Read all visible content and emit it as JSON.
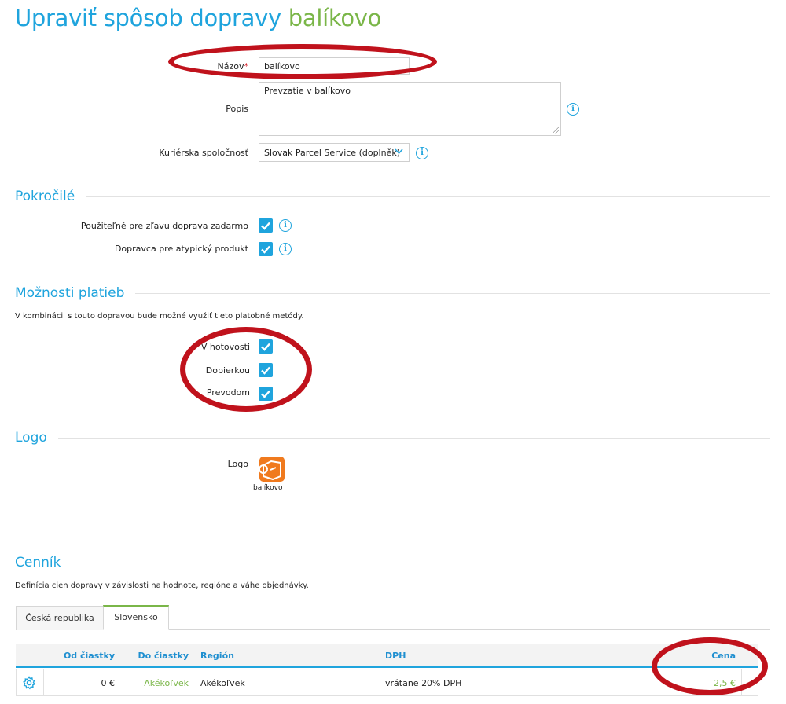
{
  "title": {
    "main": "Upraviť spôsob dopravy",
    "name": "balíkovo"
  },
  "form": {
    "name_label": "Názov",
    "required_mark": "*",
    "name_value": "balíkovo",
    "desc_label": "Popis",
    "desc_value": "Prevzatie v balíkovo",
    "courier_label": "Kuriérska spoločnosť",
    "courier_value": "Slovak Parcel Service (doplněk)",
    "info_glyph": "i"
  },
  "advanced": {
    "title": "Pokročilé",
    "free_shipping_label": "Použiteľné pre zľavu doprava zadarmo",
    "atypical_label": "Dopravca pre atypický produkt"
  },
  "payments": {
    "title": "Možnosti platieb",
    "description": "V kombinácii s touto dopravou bude možné využiť tieto platobné metódy.",
    "methods": [
      "V hotovosti",
      "Dobierkou",
      "Prevodom"
    ]
  },
  "logo": {
    "title": "Logo",
    "label": "Logo",
    "caption": "balíkovo",
    "color": "#f07a1e"
  },
  "pricing": {
    "title": "Cenník",
    "description": "Definícia cien dopravy v závislosti na hodnote, regióne a váhe objednávky.",
    "tabs": [
      "Česká republika",
      "Slovensko"
    ],
    "active_tab": 1,
    "columns": [
      "Od čiastky",
      "Do čiastky",
      "Región",
      "DPH",
      "Cena"
    ],
    "rows": [
      {
        "from": "0 €",
        "to": "Akékoľvek",
        "region": "Akékoľvek",
        "vat": "vrátane 20% DPH",
        "price": "2,5 €"
      }
    ]
  },
  "colors": {
    "accent": "#1fa4dd",
    "green": "#7ab648",
    "annotation": "#c0121c"
  }
}
